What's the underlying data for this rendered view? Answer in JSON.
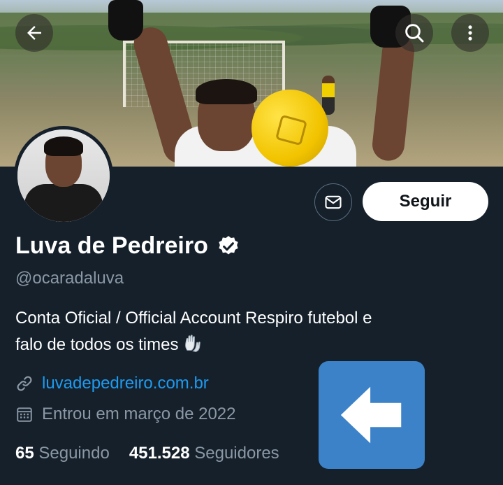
{
  "header": {
    "back_icon": "arrow-left-icon",
    "search_icon": "search-icon",
    "more_icon": "more-vertical-icon"
  },
  "profile": {
    "display_name": "Luva de Pedreiro",
    "verified_icon": "verified-badge-icon",
    "handle": "@ocaradaluva",
    "bio_line1": "Conta Oficial / Official Account  Respiro futebol e",
    "bio_line2": "falo de todos os times",
    "bio_emoji_icon": "gloves-emoji-icon",
    "link_icon": "link-icon",
    "website": "luvadepedreiro.com.br",
    "joined_icon": "calendar-icon",
    "joined": "Entrou em março de 2022"
  },
  "actions": {
    "message_icon": "mail-icon",
    "follow_label": "Seguir"
  },
  "stats": {
    "following_count": "65",
    "following_label": "Seguindo",
    "followers_count": "451.528",
    "followers_label": "Seguidores"
  },
  "overlay": {
    "arrow_icon": "arrow-left-overlay-icon"
  },
  "colors": {
    "background": "#15202b",
    "link": "#1d9bf0",
    "secondary_text": "#8b98a5",
    "overlay_blue": "#3b82c8"
  }
}
